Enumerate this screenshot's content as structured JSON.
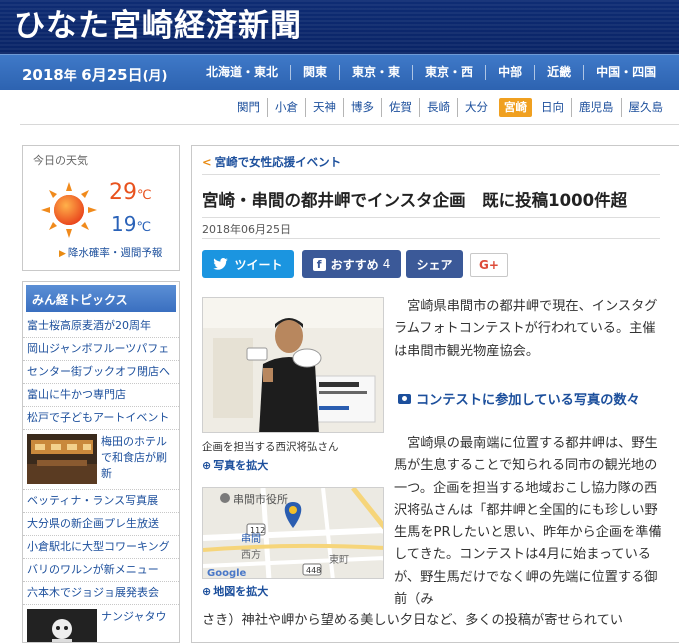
{
  "header": {
    "site_title": "ひなた宮崎経済新聞",
    "date_year": "2018",
    "date_year_suffix": "年",
    "date_md": "6月25日",
    "date_dow": "(月)",
    "regions": [
      "北海道・東北",
      "関東",
      "東京・東",
      "東京・西",
      "中部",
      "近畿",
      "中国・四国"
    ]
  },
  "city_nav": {
    "cities": [
      "関門",
      "小倉",
      "天神",
      "博多",
      "佐賀",
      "長崎",
      "大分",
      "宮崎",
      "日向",
      "鹿児島",
      "屋久島"
    ],
    "active": "宮崎"
  },
  "weather": {
    "heading": "今日の天気",
    "icon": "sun-icon",
    "high": "29",
    "low": "19",
    "unit": "℃",
    "forecast_link": "降水確率・週間予報"
  },
  "topics": {
    "heading": "みん経トピックス",
    "items_top": [
      "富士桜高原麦酒が20周年",
      "岡山ジャンボフルーツパフェ",
      "センター街ブックオフ閉店へ",
      "富山に牛かつ専門店",
      "松戸で子どもアートイベント"
    ],
    "image_item_1": "梅田のホテルで和食店が刷新",
    "items_mid": [
      "ベッティナ・ランス写真展",
      "大分県の新企画プレ生放送",
      "小倉駅北に大型コワーキング",
      "バリのワルンが新メニュー",
      "六本木でジョジョ展発表会"
    ],
    "image_item_2": "ナンジャタウ"
  },
  "article": {
    "breadcrumb": "宮崎で女性応援イベント",
    "headline": "宮崎・串間の都井岬でインスタ企画　既に投稿1000件超",
    "date": "2018年06月25日",
    "share": {
      "tweet": "ツイート",
      "recommend": "おすすめ",
      "recommend_count": "4",
      "share": "シェア",
      "gplus": "G+"
    },
    "photo_caption": "企画を担当する西沢将弘さん",
    "photo_zoom": "写真を拡大",
    "map_zoom": "地図を拡大",
    "map_labels": {
      "city_hall": "串間市役所",
      "station": "串間",
      "route": "112",
      "route2": "448",
      "west": "西方",
      "east": "東町",
      "google": "Google"
    },
    "lead": "　宮崎県串間市の都井岬で現在、インスタグラムフォトコンテストが行われている。主催は串間市観光物産協会。",
    "subhead": "コンテストに参加している写真の数々",
    "body_1": "　宮崎県の最南端に位置する都井岬は、野生馬が生息することで知られる同市の観光地の一つ。企画を担当する地域おこし協力隊の西沢将弘さんは「都井岬と全国的にも珍しい野生馬をPRしたいと思い、昨年から企画を準備してきた。コンテストは4月に始まっているが、野生馬だけでなく岬の先端に位置する御前（み",
    "body_2": "さき）神社や岬から望める美しい夕日など、多くの投稿が寄せられてい"
  }
}
